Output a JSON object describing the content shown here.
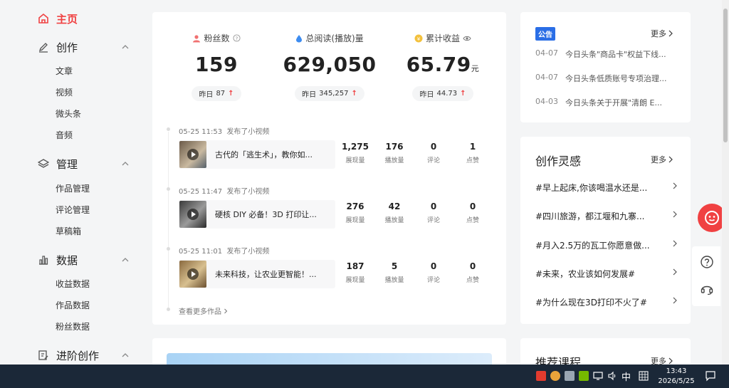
{
  "sidebar": {
    "home": "主页",
    "create": {
      "label": "创作",
      "items": [
        "文章",
        "视频",
        "微头条",
        "音频"
      ]
    },
    "manage": {
      "label": "管理",
      "items": [
        "作品管理",
        "评论管理",
        "草稿箱"
      ]
    },
    "data": {
      "label": "数据",
      "items": [
        "收益数据",
        "作品数据",
        "粉丝数据"
      ]
    },
    "advanced": {
      "label": "进阶创作"
    }
  },
  "stats": [
    {
      "label": "粉丝数",
      "value": "159",
      "unit": "",
      "yesterday_label": "昨日",
      "yesterday": "87"
    },
    {
      "label": "总阅读(播放)量",
      "value": "629,050",
      "unit": "",
      "yesterday_label": "昨日",
      "yesterday": "345,257"
    },
    {
      "label": "累计收益",
      "value": "65.79",
      "unit": "元",
      "yesterday_label": "昨日",
      "yesterday": "44.73"
    }
  ],
  "feed": [
    {
      "time": "05-25 11:53",
      "action": "发布了小视频",
      "title": "古代的「逃生术」，教你如...",
      "impressions": "1,275",
      "plays": "176",
      "comments": "0",
      "likes": "1"
    },
    {
      "time": "05-25 11:47",
      "action": "发布了小视频",
      "title": "硬核 DIY 必备！3D 打印让...",
      "impressions": "276",
      "plays": "42",
      "comments": "0",
      "likes": "0"
    },
    {
      "time": "05-25 11:01",
      "action": "发布了小视频",
      "title": "未来科技，让农业更智能！...",
      "impressions": "187",
      "plays": "5",
      "comments": "0",
      "likes": "0"
    }
  ],
  "metric_labels": {
    "impressions": "展现量",
    "plays": "播放量",
    "comments": "评论",
    "likes": "点赞"
  },
  "feed_more": "查看更多作品",
  "notice": {
    "badge": "公告",
    "more": "更多",
    "items": [
      {
        "date": "04-07",
        "text": "今日头条\"商品卡\"权益下线..."
      },
      {
        "date": "04-07",
        "text": "今日头条低质账号专项治理..."
      },
      {
        "date": "04-03",
        "text": "今日头条关于开展\"清朗 E..."
      }
    ]
  },
  "inspiration": {
    "title": "创作灵感",
    "more": "更多",
    "items": [
      "#早上起床,你该喝温水还是...",
      "#四川旅游，都江堰和九寨...",
      "#月入2.5万的瓦工你愿意做...",
      "#未来，农业该如何发展#",
      "#为什么现在3D打印不火了#"
    ]
  },
  "courses": {
    "title": "推荐课程",
    "more": "更多"
  },
  "taskbar": {
    "ime": "中",
    "time": "13:43",
    "date": "2026/5/25"
  },
  "colors": {
    "accent": "#f04142",
    "notice_badge": "#2a6ee6"
  }
}
